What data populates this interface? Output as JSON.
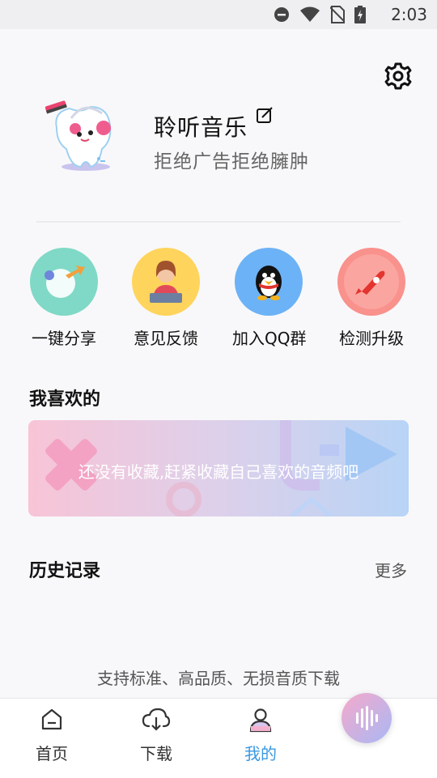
{
  "status_bar": {
    "time": "2:03"
  },
  "profile": {
    "username": "聆听音乐",
    "slogan": "拒绝广告拒绝臃肿"
  },
  "quick_actions": [
    {
      "label": "一键分享",
      "icon": "share-icon",
      "color": "#7fd9c6"
    },
    {
      "label": "意见反馈",
      "icon": "feedback-icon",
      "color": "#ffd45c"
    },
    {
      "label": "加入QQ群",
      "icon": "qq-penguin-icon",
      "color": "#6cb2f6"
    },
    {
      "label": "检测升级",
      "icon": "rocket-icon",
      "color": "#f9918c"
    }
  ],
  "favorites": {
    "title": "我喜欢的",
    "empty_message": "还没有收藏,赶紧收藏自己喜欢的音频吧"
  },
  "history": {
    "title": "历史记录",
    "more_label": "更多"
  },
  "support_text": "支持标准、高品质、无损音质下载",
  "tabs": [
    {
      "label": "首页",
      "icon": "home-icon",
      "active": false
    },
    {
      "label": "下载",
      "icon": "cloud-download-icon",
      "active": false
    },
    {
      "label": "我的",
      "icon": "profile-icon",
      "active": true
    }
  ],
  "colors": {
    "accent": "#3a98e0",
    "background": "#f8f8fa"
  }
}
